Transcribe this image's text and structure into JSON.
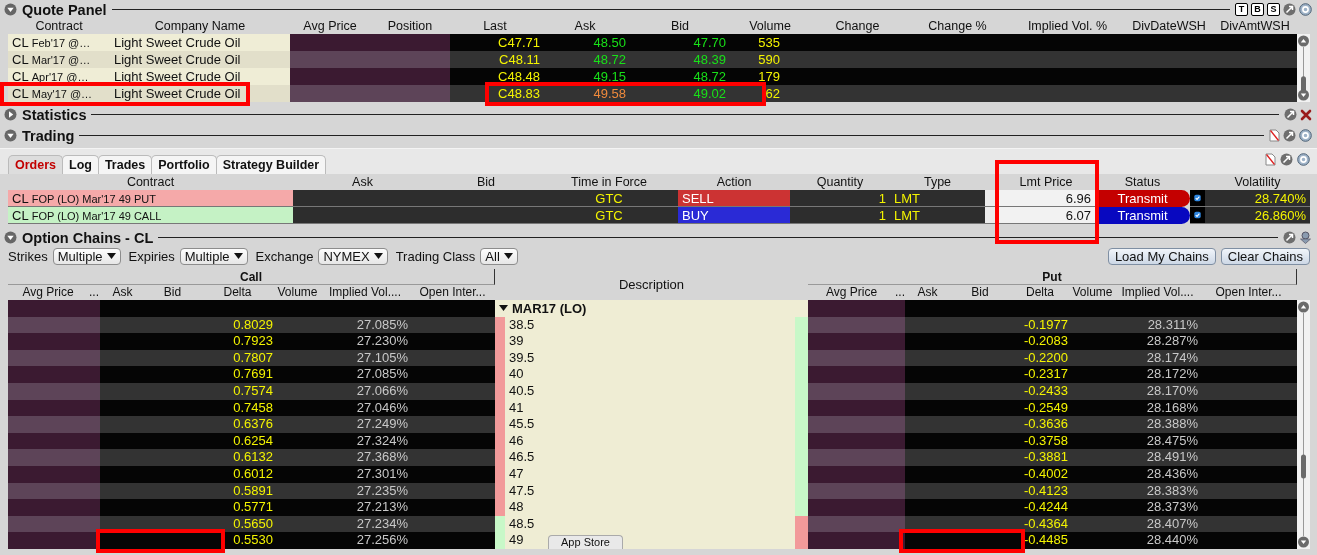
{
  "quote_panel": {
    "title": "Quote Panel",
    "expanded": true,
    "tools": [
      {
        "kind": "letter",
        "label": "T"
      },
      {
        "kind": "letter",
        "label": "B"
      },
      {
        "kind": "letter",
        "label": "S"
      },
      {
        "kind": "detach"
      },
      {
        "kind": "help"
      }
    ],
    "columns": [
      "Contract",
      "Company Name",
      "Avg Price",
      "Position",
      "Last",
      "Ask",
      "Bid",
      "Volume",
      "Change",
      "Change %",
      "Implied Vol. %",
      "DivDateWSH",
      "DivAmtWSH"
    ],
    "rows": [
      {
        "symbol": "CL",
        "detail": "Feb'17 @…",
        "company": "Light Sweet Crude Oil",
        "last": "C47.71",
        "ask": {
          "text": "48.50",
          "flagged": false
        },
        "bid": "47.70",
        "volume": "535",
        "highlighted": false
      },
      {
        "symbol": "CL",
        "detail": "Mar'17 @…",
        "company": "Light Sweet Crude Oil",
        "last": "C48.11",
        "ask": {
          "text": "48.72",
          "flagged": false
        },
        "bid": "48.39",
        "volume": "590",
        "highlighted": false
      },
      {
        "symbol": "CL",
        "detail": "Apr'17 @…",
        "company": "Light Sweet Crude Oil",
        "last": "C48.48",
        "ask": {
          "text": "49.15",
          "flagged": false
        },
        "bid": "48.72",
        "volume": "179",
        "highlighted": false
      },
      {
        "symbol": "CL",
        "detail": "May'17 @…",
        "company": "Light Sweet Crude Oil",
        "last": "C48.83",
        "ask": {
          "text": "49.58",
          "flagged": true
        },
        "bid": "49.02",
        "volume": "62",
        "highlighted": true
      }
    ]
  },
  "statistics": {
    "title": "Statistics",
    "expanded": false,
    "tools": [
      {
        "kind": "detach"
      },
      {
        "kind": "close"
      }
    ]
  },
  "trading": {
    "title": "Trading",
    "expanded": true,
    "tabs": [
      {
        "label": "Orders",
        "selected": true
      },
      {
        "label": "Log",
        "selected": false
      },
      {
        "label": "Trades",
        "selected": false
      },
      {
        "label": "Portfolio",
        "selected": false
      },
      {
        "label": "Strategy Builder",
        "selected": false
      }
    ],
    "tools": [
      {
        "kind": "page"
      },
      {
        "kind": "detach"
      },
      {
        "kind": "help"
      }
    ],
    "columns": [
      "Contract",
      "Ask",
      "Bid",
      "Time in Force",
      "Action",
      "Quantity",
      "Type",
      "Lmt Price",
      "Status",
      "Volatility"
    ],
    "lmt_price_highlighted": true,
    "orders": [
      {
        "kind": "sell",
        "symbol": "CL",
        "detail": "FOP (LO) Mar'17 49 PUT",
        "tif": "GTC",
        "action": "SELL",
        "quantity": "1",
        "type": "LMT",
        "lmt_price": "6.96",
        "status": "Transmit",
        "checked": true,
        "volatility": "28.740%"
      },
      {
        "kind": "buy",
        "symbol": "CL",
        "detail": "FOP (LO) Mar'17 49 CALL",
        "tif": "GTC",
        "action": "BUY",
        "quantity": "1",
        "type": "LMT",
        "lmt_price": "6.07",
        "status": "Transmit",
        "checked": true,
        "volatility": "26.860%"
      }
    ]
  },
  "option_chains": {
    "title": "Option Chains - CL",
    "expanded": true,
    "tools": [
      {
        "kind": "detach"
      },
      {
        "kind": "pin"
      }
    ],
    "filters": [
      {
        "label": "Strikes",
        "value": "Multiple"
      },
      {
        "label": "Expiries",
        "value": "Multiple"
      },
      {
        "label": "Exchange",
        "value": "NYMEX"
      },
      {
        "label": "Trading Class",
        "value": "All"
      }
    ],
    "buttons": [
      "Load My Chains",
      "Clear Chains"
    ],
    "call": {
      "title": "Call",
      "columns": [
        "Avg Price",
        "...",
        "Ask",
        "Bid",
        "Delta",
        "Volume",
        "Implied Vol....",
        "Open Inter..."
      ]
    },
    "description_header": "Description",
    "put": {
      "title": "Put",
      "columns": [
        "Avg Price",
        "...",
        "Ask",
        "Bid",
        "Delta",
        "Volume",
        "Implied Vol....",
        "Open Inter..."
      ]
    },
    "expiry": {
      "label": "MAR17 (LO)",
      "expanded": true
    },
    "rows": [
      {
        "strike": "38.5",
        "call_delta": "0.8029",
        "call_iv": "27.085%",
        "put_delta": "-0.1977",
        "put_iv": "28.311%",
        "call_marker": {
          "color": "#f29a9a"
        },
        "put_marker": {
          "color": "#c8f8c8"
        },
        "highlighted": false
      },
      {
        "strike": "39",
        "call_delta": "0.7923",
        "call_iv": "27.230%",
        "put_delta": "-0.2083",
        "put_iv": "28.287%",
        "call_marker": {
          "color": "#f29a9a"
        },
        "put_marker": {
          "color": "#c8f8c8"
        },
        "highlighted": false
      },
      {
        "strike": "39.5",
        "call_delta": "0.7807",
        "call_iv": "27.105%",
        "put_delta": "-0.2200",
        "put_iv": "28.174%",
        "call_marker": {
          "color": "#f29a9a"
        },
        "put_marker": {
          "color": "#c8f8c8"
        },
        "highlighted": false
      },
      {
        "strike": "40",
        "call_delta": "0.7691",
        "call_iv": "27.085%",
        "put_delta": "-0.2317",
        "put_iv": "28.172%",
        "call_marker": {
          "color": "#f29a9a"
        },
        "put_marker": {
          "color": "#c8f8c8"
        },
        "highlighted": false
      },
      {
        "strike": "40.5",
        "call_delta": "0.7574",
        "call_iv": "27.066%",
        "put_delta": "-0.2433",
        "put_iv": "28.170%",
        "call_marker": {
          "color": "#f29a9a"
        },
        "put_marker": {
          "color": "#c8f8c8"
        },
        "highlighted": false
      },
      {
        "strike": "41",
        "call_delta": "0.7458",
        "call_iv": "27.046%",
        "put_delta": "-0.2549",
        "put_iv": "28.168%",
        "call_marker": {
          "color": "#f29a9a"
        },
        "put_marker": {
          "color": "#c8f8c8"
        },
        "highlighted": false
      },
      {
        "strike": "45.5",
        "call_delta": "0.6376",
        "call_iv": "27.249%",
        "put_delta": "-0.3636",
        "put_iv": "28.388%",
        "call_marker": {
          "color": "#f29a9a"
        },
        "put_marker": {
          "color": "#c8f8c8"
        },
        "highlighted": false
      },
      {
        "strike": "46",
        "call_delta": "0.6254",
        "call_iv": "27.324%",
        "put_delta": "-0.3758",
        "put_iv": "28.475%",
        "call_marker": {
          "color": "#f29a9a"
        },
        "put_marker": {
          "color": "#c8f8c8"
        },
        "highlighted": false
      },
      {
        "strike": "46.5",
        "call_delta": "0.6132",
        "call_iv": "27.368%",
        "put_delta": "-0.3881",
        "put_iv": "28.491%",
        "call_marker": {
          "color": "#f29a9a"
        },
        "put_marker": {
          "color": "#c8f8c8"
        },
        "highlighted": false
      },
      {
        "strike": "47",
        "call_delta": "0.6012",
        "call_iv": "27.301%",
        "put_delta": "-0.4002",
        "put_iv": "28.436%",
        "call_marker": {
          "color": "#f29a9a"
        },
        "put_marker": {
          "color": "#c8f8c8"
        },
        "highlighted": false
      },
      {
        "strike": "47.5",
        "call_delta": "0.5891",
        "call_iv": "27.235%",
        "put_delta": "-0.4123",
        "put_iv": "28.383%",
        "call_marker": {
          "color": "#f29a9a"
        },
        "put_marker": {
          "color": "#c8f8c8"
        },
        "highlighted": false
      },
      {
        "strike": "48",
        "call_delta": "0.5771",
        "call_iv": "27.213%",
        "put_delta": "-0.4244",
        "put_iv": "28.373%",
        "call_marker": {
          "color": "#f29a9a"
        },
        "put_marker": {
          "color": "#c8f8c8"
        },
        "highlighted": false
      },
      {
        "strike": "48.5",
        "call_delta": "0.5650",
        "call_iv": "27.234%",
        "put_delta": "-0.4364",
        "put_iv": "28.407%",
        "call_marker": {
          "color": "#c8f8c8"
        },
        "put_marker": {
          "color": "#f29a9a"
        },
        "highlighted": false
      },
      {
        "strike": "49",
        "call_delta": "0.5530",
        "call_iv": "27.256%",
        "put_delta": "-0.4485",
        "put_iv": "28.440%",
        "call_marker": {
          "color": "#c8f8c8"
        },
        "put_marker": {
          "color": "#f29a9a"
        },
        "highlighted": true
      }
    ],
    "tooltip": "App Store"
  }
}
